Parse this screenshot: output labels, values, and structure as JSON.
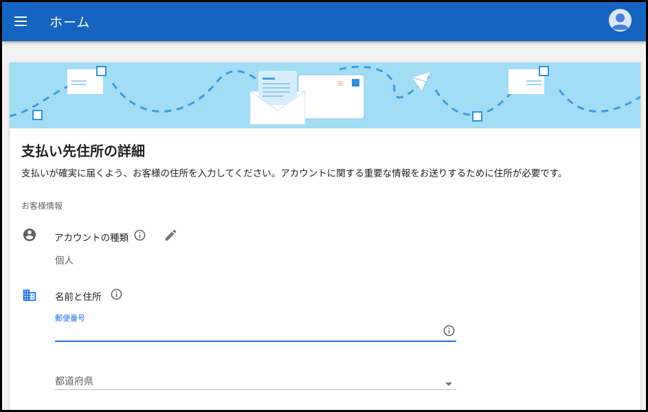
{
  "appbar": {
    "title": "ホーム",
    "menu_icon": "hamburger-menu-icon",
    "avatar_icon": "account-circle-icon"
  },
  "colors": {
    "appbar": "#1565c0",
    "banner": "#a3dcf5",
    "accent": "#1a73e8"
  },
  "card": {
    "title": "支払い先住所の詳細",
    "description": "支払いが確実に届くよう、お客様の住所を入力してください。アカウントに関する重要な情報をお送りするために住所が必要です。",
    "section_label": "お客様情報",
    "account_type": {
      "label": "アカウントの種類",
      "value": "個人",
      "icon": "person-circle-icon",
      "info_icon": "info-icon",
      "edit_icon": "pencil-edit-icon"
    },
    "name_address": {
      "label": "名前と住所",
      "icon": "building-icon",
      "info_icon": "info-icon"
    },
    "postal_code": {
      "label": "郵便番号",
      "value": "",
      "info_icon": "info-icon"
    },
    "prefecture": {
      "placeholder": "都道府県",
      "dropdown_icon": "dropdown-arrow-icon"
    }
  }
}
